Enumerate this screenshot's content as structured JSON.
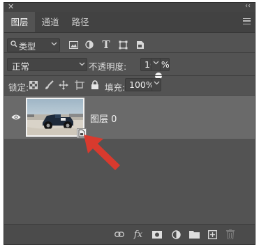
{
  "panel": {
    "close_glyph": "✕",
    "collapse_glyph": "‹‹",
    "tabs": [
      {
        "label": "图层"
      },
      {
        "label": "通道"
      },
      {
        "label": "路径"
      }
    ],
    "active_tab": "图层",
    "menu_icon": "hamburger-menu-icon"
  },
  "filter": {
    "kind_label": "类型",
    "icons": [
      "pixel-layer-filter-icon",
      "adjustment-layer-filter-icon",
      "type-layer-filter-icon",
      "shape-layer-filter-icon",
      "smart-object-filter-icon",
      "filter-toggle-icon"
    ]
  },
  "blend": {
    "mode_value": "正常",
    "opacity_label": "不透明度:",
    "opacity_value": "100%"
  },
  "locks": {
    "label": "锁定:",
    "icons": [
      "lock-transparent-pixels-icon",
      "lock-image-pixels-icon",
      "lock-position-icon",
      "lock-artboard-icon",
      "lock-all-icon"
    ],
    "fill_label": "填充:",
    "fill_value": "100%"
  },
  "layers": [
    {
      "name": "图层 0",
      "visible": true,
      "is_smart_object": true,
      "selected": true
    }
  ],
  "bottom_icons": [
    "link-layers-icon",
    "fx-icon",
    "add-mask-icon",
    "new-adjustment-layer-icon",
    "new-group-icon",
    "new-layer-icon",
    "delete-layer-icon"
  ],
  "fx_label": "fx",
  "colors": {
    "panel_bg": "#535353",
    "selected_row": "#6a6a6a",
    "annotation_arrow": "#d83a2e"
  }
}
